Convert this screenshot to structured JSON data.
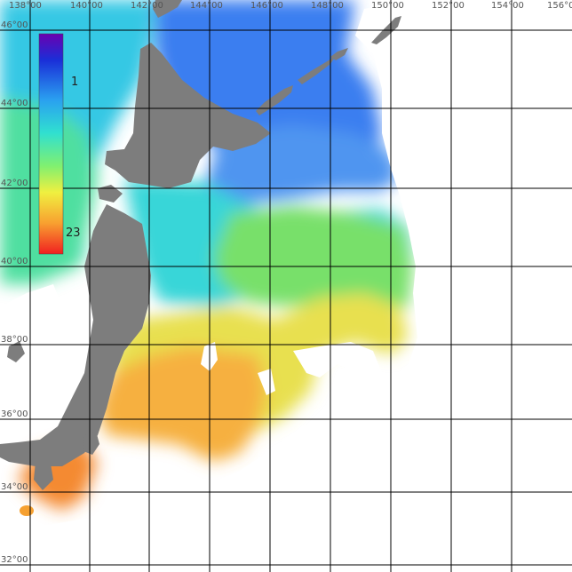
{
  "map": {
    "longitude_labels": [
      "138°00",
      "140°00",
      "142°00",
      "144°00",
      "146°00",
      "148°00",
      "150°00",
      "152°00",
      "154°00",
      "156°0"
    ],
    "latitude_labels": [
      "46°00",
      "44°00",
      "42°00",
      "40°00",
      "38°00",
      "36°00",
      "34°00",
      "32°00"
    ],
    "land_color": "#7d7d7d",
    "no_data_color": "#ffffff",
    "grid_color": "#000000"
  },
  "colorbar": {
    "max_label": "1",
    "min_label": "23",
    "colors_top_to_bottom": [
      "#6a00b0",
      "#1a2fd8",
      "#2aa0f0",
      "#30e0d0",
      "#80f070",
      "#f0f040",
      "#f8a030",
      "#f02020"
    ]
  }
}
